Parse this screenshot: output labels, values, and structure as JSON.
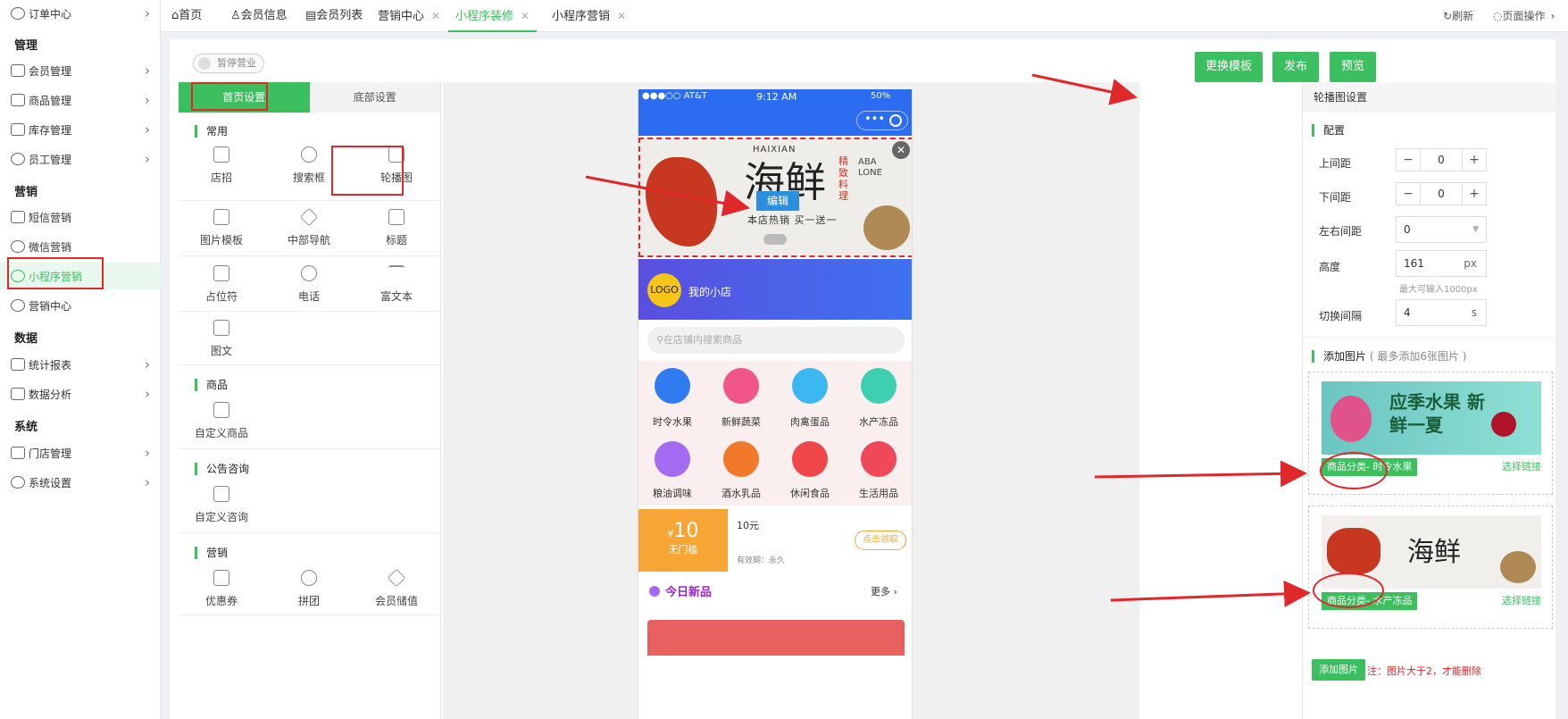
{
  "nav": {
    "order_center": "订单中心",
    "sec_manage": "管理",
    "members": "会员管理",
    "products": "商品管理",
    "stock": "库存管理",
    "staff": "员工管理",
    "sec_marketing": "营销",
    "sms": "短信营销",
    "wechat": "微信营销",
    "miniprogram": "小程序营销",
    "marketing_center": "营销中心",
    "sec_data": "数据",
    "reports": "统计报表",
    "analysis": "数据分析",
    "sec_system": "系统",
    "stores": "门店管理",
    "settings": "系统设置"
  },
  "tabs": {
    "items": [
      "首页",
      "会员信息",
      "会员列表",
      "营销中心",
      "小程序装修",
      "小程序营销"
    ],
    "refresh": "刷新",
    "page_ops": "页面操作"
  },
  "toolbar": {
    "pause": "暂停营业",
    "change_template": "更换模板",
    "publish": "发布",
    "preview": "预览"
  },
  "components": {
    "tab_home": "首页设置",
    "tab_bottom": "底部设置",
    "cat_common": "常用",
    "common": [
      "店招",
      "搜索框",
      "轮播图",
      "图片模板",
      "中部导航",
      "标题",
      "占位符",
      "电话",
      "富文本",
      "图文"
    ],
    "cat_goods": "商品",
    "goods": [
      "自定义商品"
    ],
    "cat_notice": "公告咨询",
    "notice": [
      "自定义咨询"
    ],
    "cat_marketing": "营销",
    "marketing": [
      "优惠券",
      "拼团",
      "会员储值"
    ]
  },
  "phone": {
    "carrier": "●●●○○ AT&T",
    "time": "9:12 AM",
    "battery": "50%",
    "banner_title": "海鲜",
    "banner_en": "HAIXIAN",
    "banner_side": "精致料理",
    "banner_tag": "本店热销 买一送一",
    "banner_edit": "编辑",
    "banner_abalone": "ABA LONE",
    "logo": "LOGO",
    "store_name": "我的小店",
    "search_placeholder": "在店铺内搜索商品",
    "categories": [
      "时令水果",
      "新鲜蔬菜",
      "肉禽蛋品",
      "水产冻品",
      "粮油调味",
      "酒水乳品",
      "休闲食品",
      "生活用品"
    ],
    "coupon_amount": "10",
    "coupon_currency": "¥",
    "coupon_cond": "无门槛",
    "coupon_title": "10元",
    "coupon_valid": "有效期：永久",
    "coupon_btn": "点击领取",
    "new_title": "今日新品",
    "more": "更多"
  },
  "settings": {
    "title": "轮播图设置",
    "config": "配置",
    "top_gap": "上间距",
    "top_gap_val": "0",
    "bottom_gap": "下间距",
    "bottom_gap_val": "0",
    "lr_gap": "左右间距",
    "lr_gap_val": "0",
    "height": "高度",
    "height_val": "161",
    "height_unit": "px",
    "height_hint": "最大可输入1000px",
    "interval": "切换间隔",
    "interval_val": "4",
    "interval_unit": "s",
    "add_title": "添加图片",
    "add_hint": "( 最多添加6张图片 )",
    "img1_text": "应季水果 新鲜一夏",
    "img1_tag": "商品分类- 时令水果",
    "img1_link": "选择链接",
    "img2_title": "海鲜",
    "img2_tag": "商品分类- 水产冻品",
    "img2_link": "选择链接",
    "add_btn": "添加图片",
    "note": "注：图片大于2，才能删除"
  },
  "colors": {
    "accent": "#3cbf5e",
    "annotation": "#e0272a",
    "phone_header": "#2b6cf0"
  }
}
